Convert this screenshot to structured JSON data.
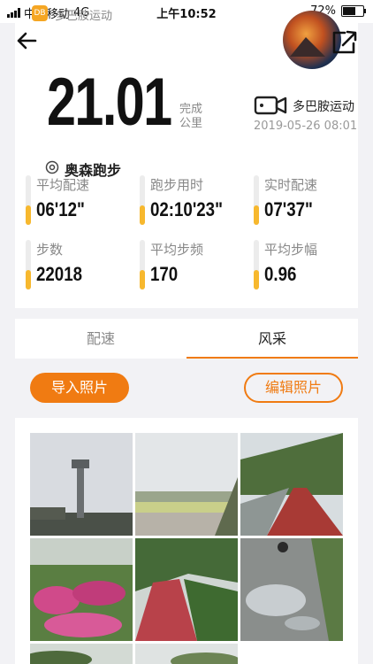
{
  "status_bar": {
    "carrier": "中国移动",
    "network": "4G",
    "time": "上午10:52",
    "battery": "72%",
    "battery_level": 0.72,
    "app_name": "多巴胺运动"
  },
  "summary": {
    "distance": "21.01",
    "unit_line1": "完成",
    "unit_line2": "公里",
    "brand": "多巴胺运动",
    "date": "2019-05-26 08:01",
    "location": "奥森跑步"
  },
  "stats": [
    {
      "label": "平均配速",
      "value": "06'12\""
    },
    {
      "label": "跑步用时",
      "value": "02:10'23\""
    },
    {
      "label": "实时配速",
      "value": "07'37\""
    },
    {
      "label": "步数",
      "value": "22018"
    },
    {
      "label": "平均步频",
      "value": "170"
    },
    {
      "label": "平均步幅",
      "value": "0.96"
    }
  ],
  "tabs": {
    "pace": "配速",
    "style": "风采"
  },
  "actions": {
    "import_photos": "导入照片",
    "edit_photos": "编辑照片"
  },
  "colors": {
    "accent": "#f07b12",
    "stat_bar": "#f7b82e"
  },
  "icons": [
    "back-arrow-icon",
    "share-icon",
    "device-camera-icon",
    "location-pin-icon"
  ]
}
